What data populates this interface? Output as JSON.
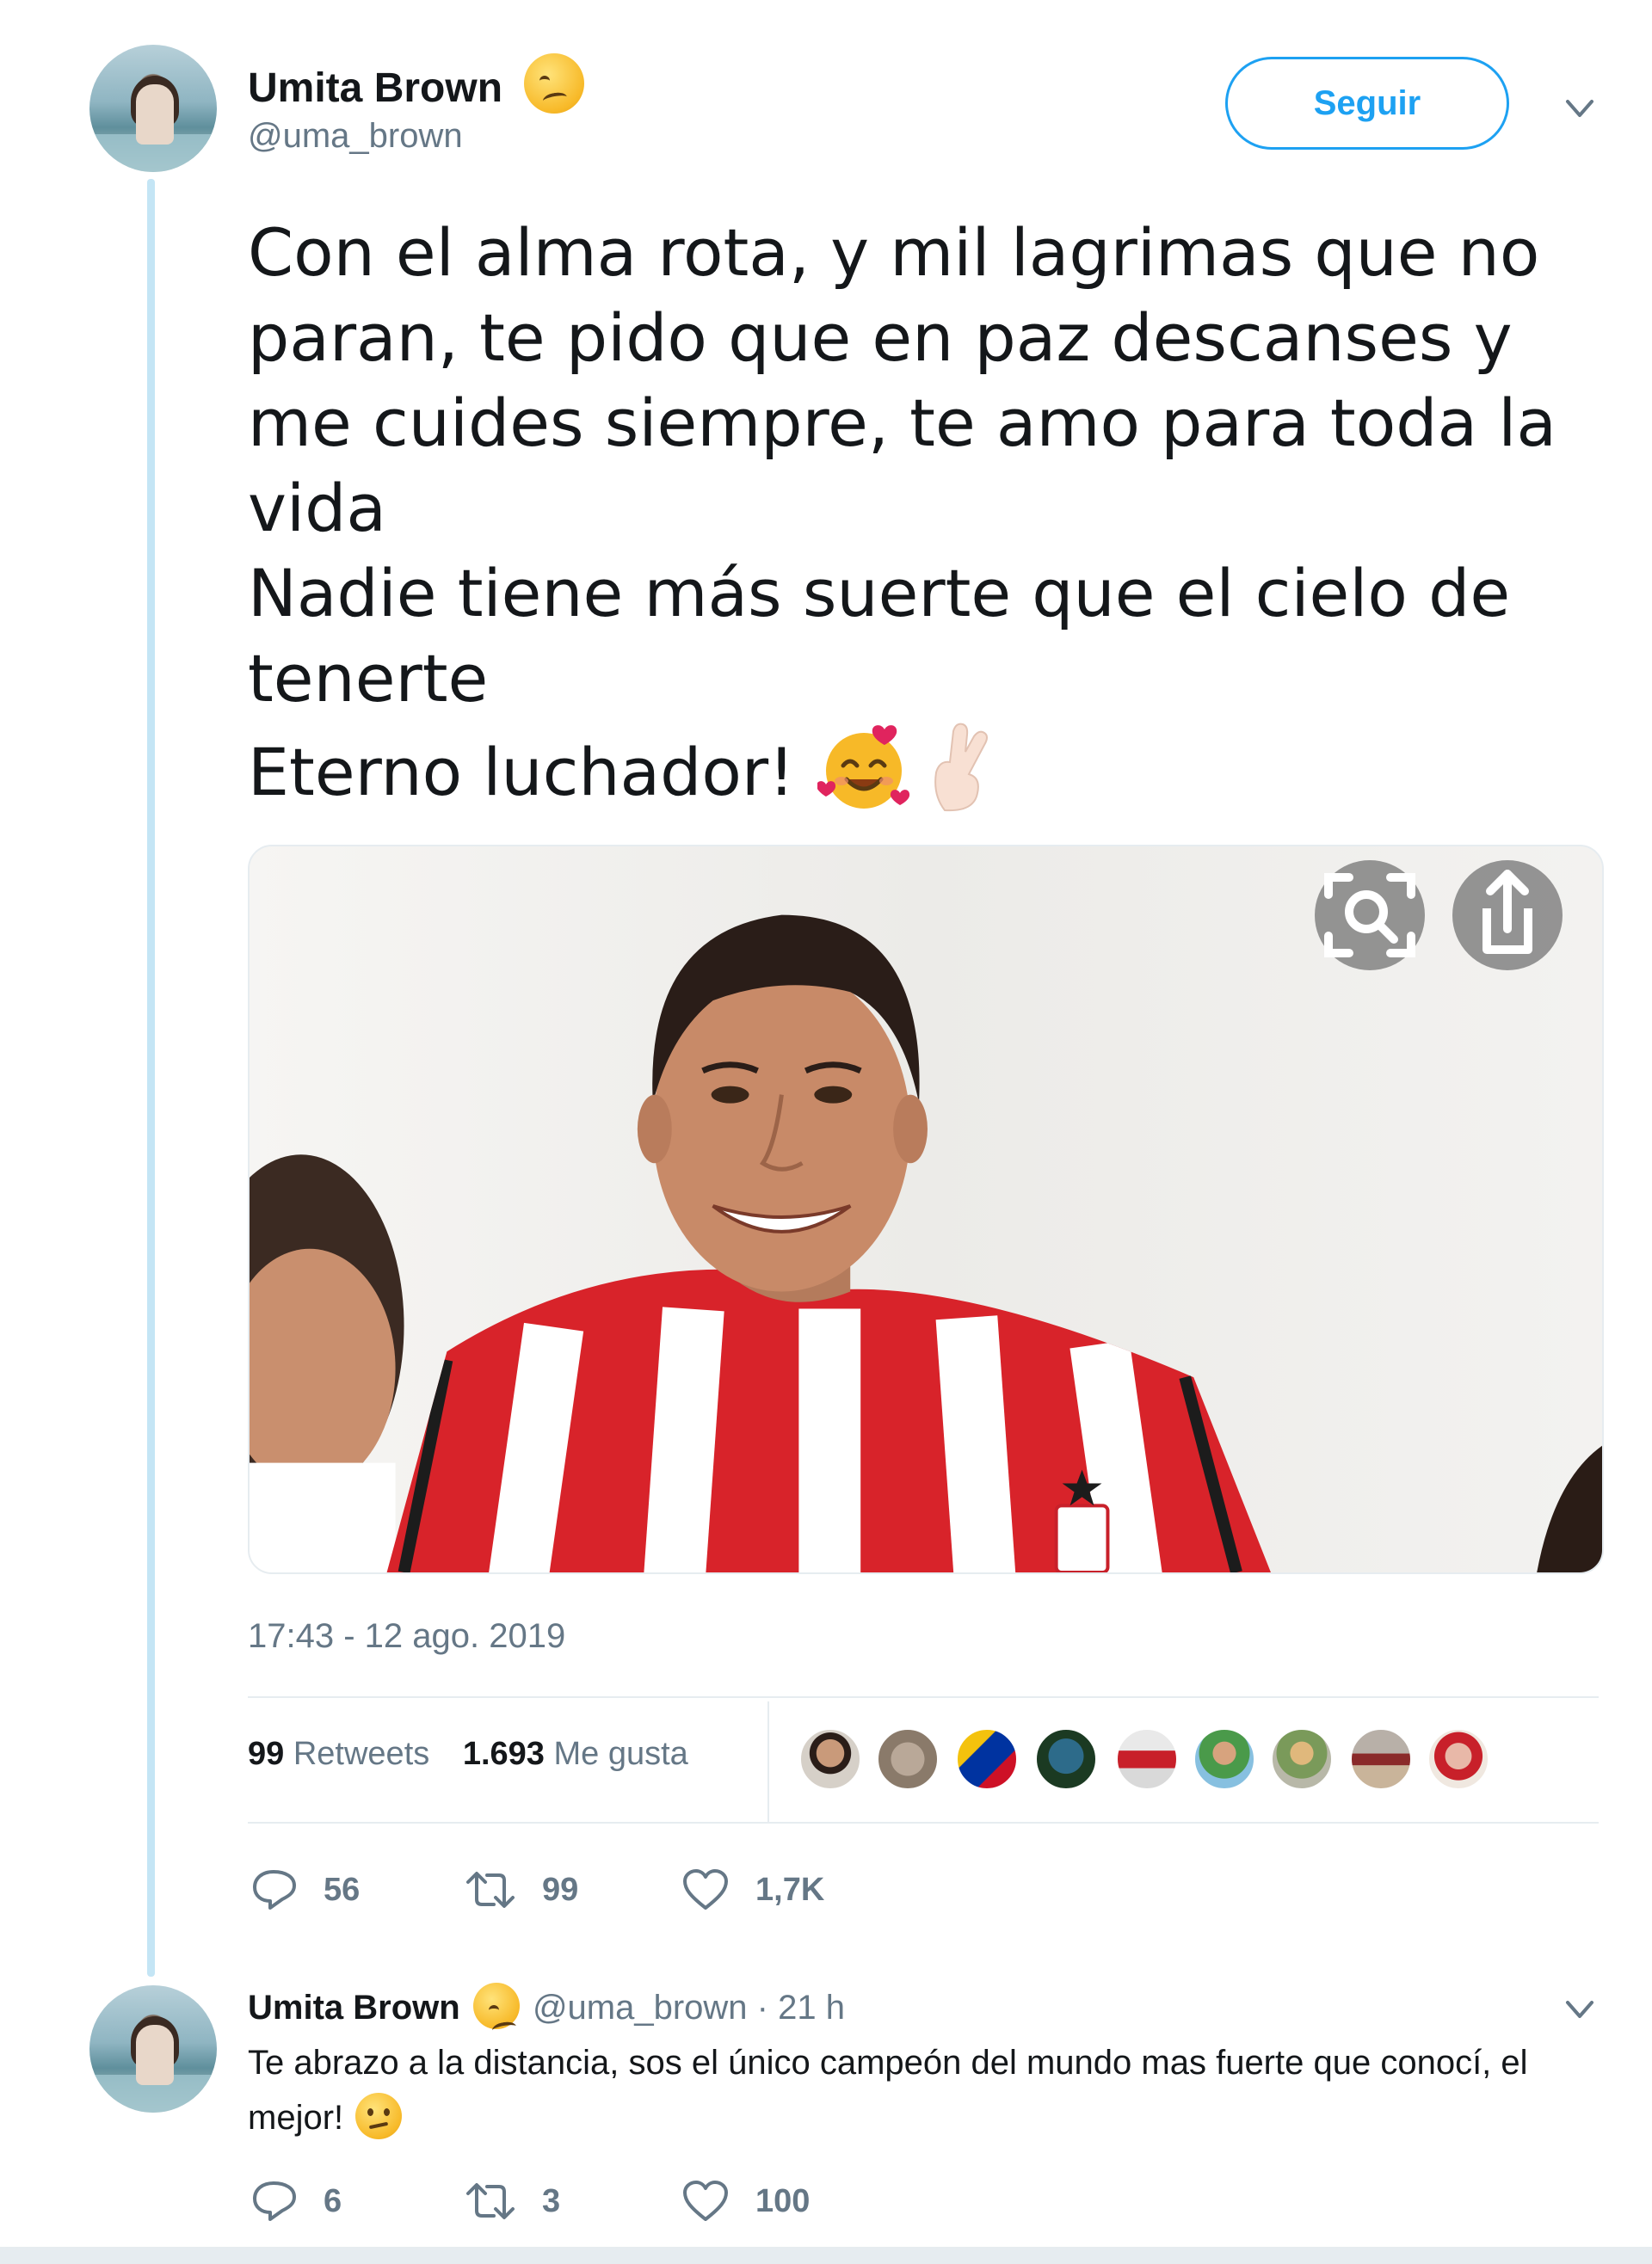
{
  "tweet": {
    "author_name": "Umita Brown",
    "author_handle": "@uma_brown",
    "follow_label": "Seguir",
    "text_lines": [
      "Con el alma rota, y mil lagrimas que no",
      "paran, te pido que en paz descanses y",
      "me cuides siempre, te amo para toda la",
      "vida",
      "Nadie tiene más suerte que el cielo de",
      "tenerte",
      "Eterno luchador!"
    ],
    "timestamp": "17:43 - 12 ago. 2019",
    "retweets_count": "99",
    "retweets_label": "Retweets",
    "likes_count": "1.693",
    "likes_label": "Me gusta",
    "replies": "56",
    "retweets": "99",
    "likes": "1,7K"
  },
  "reply": {
    "author_name": "Umita Brown",
    "author_handle": "@uma_brown",
    "time": "· 21 h",
    "text": "Te abrazo a la distancia, sos el único campeón del mundo mas fuerte que conocí, el mejor!",
    "replies": "6",
    "retweets": "3",
    "likes": "100"
  },
  "icons": {
    "author_emoji": "woozy-face-emoji",
    "text_emojis": [
      "smiling-face-with-hearts-emoji",
      "crossed-fingers-emoji"
    ],
    "reply_emoji": "confused-face-emoji",
    "photo_buttons": [
      "visual-search-icon",
      "share-icon"
    ],
    "actions": [
      "reply-icon",
      "retweet-icon",
      "like-icon"
    ]
  },
  "colors": {
    "accent": "#1da1f2",
    "thread_line": "#c4e5f5",
    "muted_text": "#657786"
  }
}
